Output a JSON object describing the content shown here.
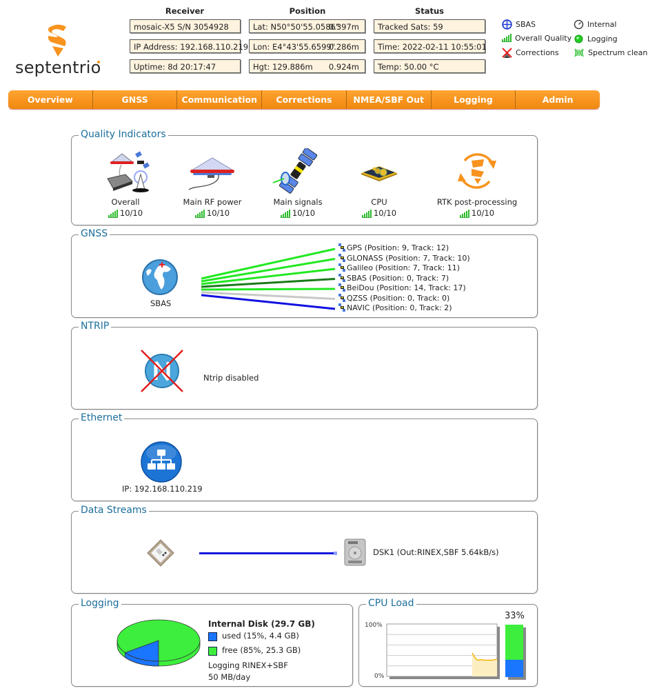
{
  "brand": {
    "name": "septentrio",
    "accent": "#f7931e"
  },
  "header": {
    "receiver": {
      "title": "Receiver",
      "model": "mosaic-X5 S/N 3054928",
      "ip": "IP Address: 192.168.110.219",
      "uptime": "Uptime: 8d 20:17:47"
    },
    "position": {
      "title": "Position",
      "lat": "Lat:  N50°50'55.0586\"",
      "lat_err": "0.397m",
      "lon": "Lon: E4°43'55.6599\"",
      "lon_err": "0.286m",
      "hgt": "Hgt: 129.886m",
      "hgt_err": "0.924m"
    },
    "status": {
      "title": "Status",
      "tracked": "Tracked Sats: 59",
      "time": "Time: 2022-02-11 10:55:01",
      "temp": "Temp: 50.00 °C"
    },
    "legend": [
      {
        "icon": "sbas-crosshair-icon",
        "label": "SBAS"
      },
      {
        "icon": "clock-icon",
        "label": "Internal"
      },
      {
        "icon": "signal-bars-icon",
        "label": "Overall Quality"
      },
      {
        "icon": "green-dot-icon",
        "label": "Logging"
      },
      {
        "icon": "corrections-disabled-icon",
        "label": "Corrections"
      },
      {
        "icon": "spectrum-icon",
        "label": "Spectrum clean"
      }
    ]
  },
  "nav": {
    "tabs": [
      "Overview",
      "GNSS",
      "Communication",
      "Corrections",
      "NMEA/SBF Out",
      "Logging",
      "Admin"
    ]
  },
  "quality": {
    "title": "Quality Indicators",
    "items": [
      {
        "label": "Overall",
        "score": "10/10",
        "icon": "overall-receiver-icon"
      },
      {
        "label": "Main RF power",
        "score": "10/10",
        "icon": "antenna-icon"
      },
      {
        "label": "Main signals",
        "score": "10/10",
        "icon": "satellite-icon"
      },
      {
        "label": "CPU",
        "score": "10/10",
        "icon": "cpu-chip-icon"
      },
      {
        "label": "RTK post-processing",
        "score": "10/10",
        "icon": "rtk-sync-icon"
      }
    ]
  },
  "gnss": {
    "title": "GNSS",
    "source_label": "SBAS",
    "constellations": [
      {
        "label": "GPS (Position: 9, Track: 12)",
        "color": "#22e822"
      },
      {
        "label": "GLONASS (Position: 7, Track: 10)",
        "color": "#22e822"
      },
      {
        "label": "Galileo (Position: 7, Track: 11)",
        "color": "#22e822"
      },
      {
        "label": "SBAS (Position: 0, Track: 7)",
        "color": "#1a7a1a"
      },
      {
        "label": "BeiDou (Position: 14, Track: 17)",
        "color": "#22e822"
      },
      {
        "label": "QZSS (Position: 0, Track: 0)",
        "color": "#c8c8c8"
      },
      {
        "label": "NAVIC (Position: 0, Track: 2)",
        "color": "#1010e0"
      }
    ]
  },
  "ntrip": {
    "title": "NTRIP",
    "status": "Ntrip disabled"
  },
  "ethernet": {
    "title": "Ethernet",
    "ip": "IP: 192.168.110.219"
  },
  "streams": {
    "title": "Data Streams",
    "dest": "DSK1 (Out:RINEX,SBF 5.64kB/s)"
  },
  "logging": {
    "title": "Logging",
    "disk": "Internal Disk (29.7 GB)",
    "used": "used (15%, 4.4 GB)",
    "free": "free (85%, 25.3 GB)",
    "used_fraction": 0.15,
    "used_color": "#1a75ff",
    "free_color": "#3dee3d",
    "mode": "Logging RINEX+SBF",
    "rate": "50 MB/day"
  },
  "cpu": {
    "title": "CPU Load",
    "current": "33%",
    "current_value": 33,
    "y_max": "100%",
    "y_min": "0%",
    "history": [
      45,
      37,
      32,
      31,
      32,
      31,
      31,
      31,
      31,
      31,
      32,
      33
    ]
  }
}
